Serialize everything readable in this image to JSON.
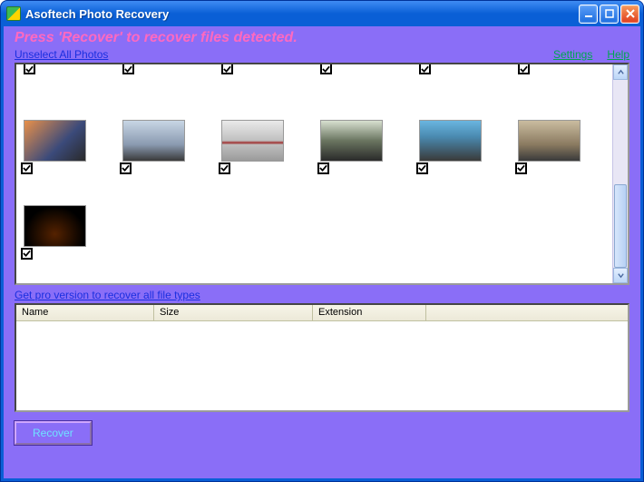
{
  "window": {
    "title": "Asoftech Photo Recovery"
  },
  "banner": "Press 'Recover' to recover files detected.",
  "links": {
    "unselect": "Unselect All Photos",
    "settings": "Settings",
    "help": "Help",
    "pro": "Get pro version to recover all file types"
  },
  "columns": {
    "name": "Name",
    "size": "Size",
    "ext": "Extension"
  },
  "buttons": {
    "recover": "Recover"
  },
  "thumbnails": {
    "top_row_checked_count": 6,
    "mid_row": [
      {
        "checked": true,
        "style": "race1"
      },
      {
        "checked": true,
        "style": "race2"
      },
      {
        "checked": true,
        "style": "race3"
      },
      {
        "checked": true,
        "style": "race4"
      },
      {
        "checked": true,
        "style": "race5"
      },
      {
        "checked": true,
        "style": "race6"
      }
    ],
    "bot_row": [
      {
        "checked": true,
        "style": "night"
      }
    ]
  }
}
